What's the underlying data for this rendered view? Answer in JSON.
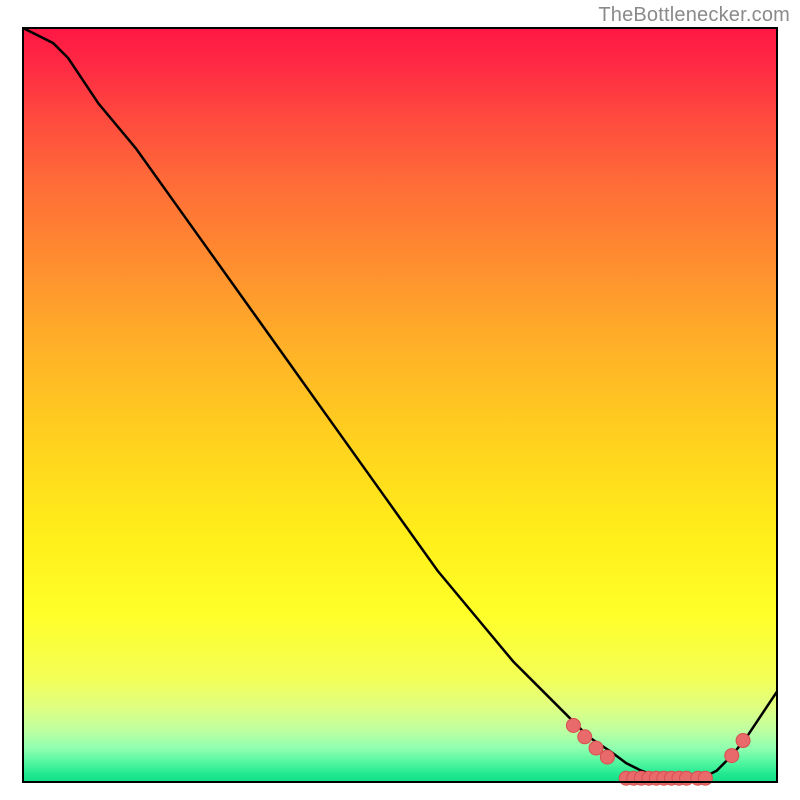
{
  "attribution": "TheBottlenecker.com",
  "chart_data": {
    "type": "line",
    "title": "",
    "xlabel": "",
    "ylabel": "",
    "xlim": [
      0,
      100
    ],
    "ylim": [
      0,
      100
    ],
    "series": [
      {
        "name": "curve",
        "x": [
          0,
          2,
          4,
          6,
          8,
          10,
          15,
          20,
          25,
          30,
          35,
          40,
          45,
          50,
          55,
          60,
          65,
          70,
          75,
          78,
          80,
          82,
          84,
          86,
          88,
          90,
          92,
          94,
          96,
          98,
          100
        ],
        "y": [
          100,
          99,
          98,
          96,
          93,
          90,
          84,
          77,
          70,
          63,
          56,
          49,
          42,
          35,
          28,
          22,
          16,
          11,
          6,
          4,
          2.5,
          1.5,
          0.8,
          0.3,
          0.2,
          0.5,
          1.5,
          3.5,
          6,
          9,
          12
        ]
      }
    ],
    "markers": {
      "name": "highlight-dots",
      "points": [
        {
          "x": 73,
          "y": 7.5
        },
        {
          "x": 74.5,
          "y": 6
        },
        {
          "x": 76,
          "y": 4.5
        },
        {
          "x": 77.5,
          "y": 3.3
        },
        {
          "x": 80,
          "y": 0.5
        },
        {
          "x": 81,
          "y": 0.5
        },
        {
          "x": 82,
          "y": 0.5
        },
        {
          "x": 83,
          "y": 0.5
        },
        {
          "x": 84,
          "y": 0.5
        },
        {
          "x": 85,
          "y": 0.5
        },
        {
          "x": 86,
          "y": 0.5
        },
        {
          "x": 87,
          "y": 0.5
        },
        {
          "x": 88,
          "y": 0.5
        },
        {
          "x": 89.5,
          "y": 0.5
        },
        {
          "x": 90.5,
          "y": 0.5
        },
        {
          "x": 94,
          "y": 3.5
        },
        {
          "x": 95.5,
          "y": 5.5
        }
      ]
    },
    "background_gradient": {
      "type": "vertical-sqrt",
      "stops": [
        {
          "t": 0.0,
          "color": "#ff1744"
        },
        {
          "t": 0.05,
          "color": "#ff2a44"
        },
        {
          "t": 0.12,
          "color": "#ff4a3e"
        },
        {
          "t": 0.2,
          "color": "#ff6a38"
        },
        {
          "t": 0.3,
          "color": "#ff8a30"
        },
        {
          "t": 0.42,
          "color": "#ffb028"
        },
        {
          "t": 0.55,
          "color": "#ffd21e"
        },
        {
          "t": 0.68,
          "color": "#fff01a"
        },
        {
          "t": 0.78,
          "color": "#ffff2a"
        },
        {
          "t": 0.86,
          "color": "#f4ff55"
        },
        {
          "t": 0.9,
          "color": "#e0ff80"
        },
        {
          "t": 0.93,
          "color": "#c0ffa0"
        },
        {
          "t": 0.955,
          "color": "#90ffb0"
        },
        {
          "t": 0.975,
          "color": "#50f6a0"
        },
        {
          "t": 0.99,
          "color": "#20e890"
        },
        {
          "t": 1.0,
          "color": "#10df88"
        }
      ]
    },
    "colors": {
      "curve": "#000000",
      "marker_fill": "#e86a6a",
      "marker_stroke": "#d94f4f",
      "frame": "#000000"
    }
  }
}
